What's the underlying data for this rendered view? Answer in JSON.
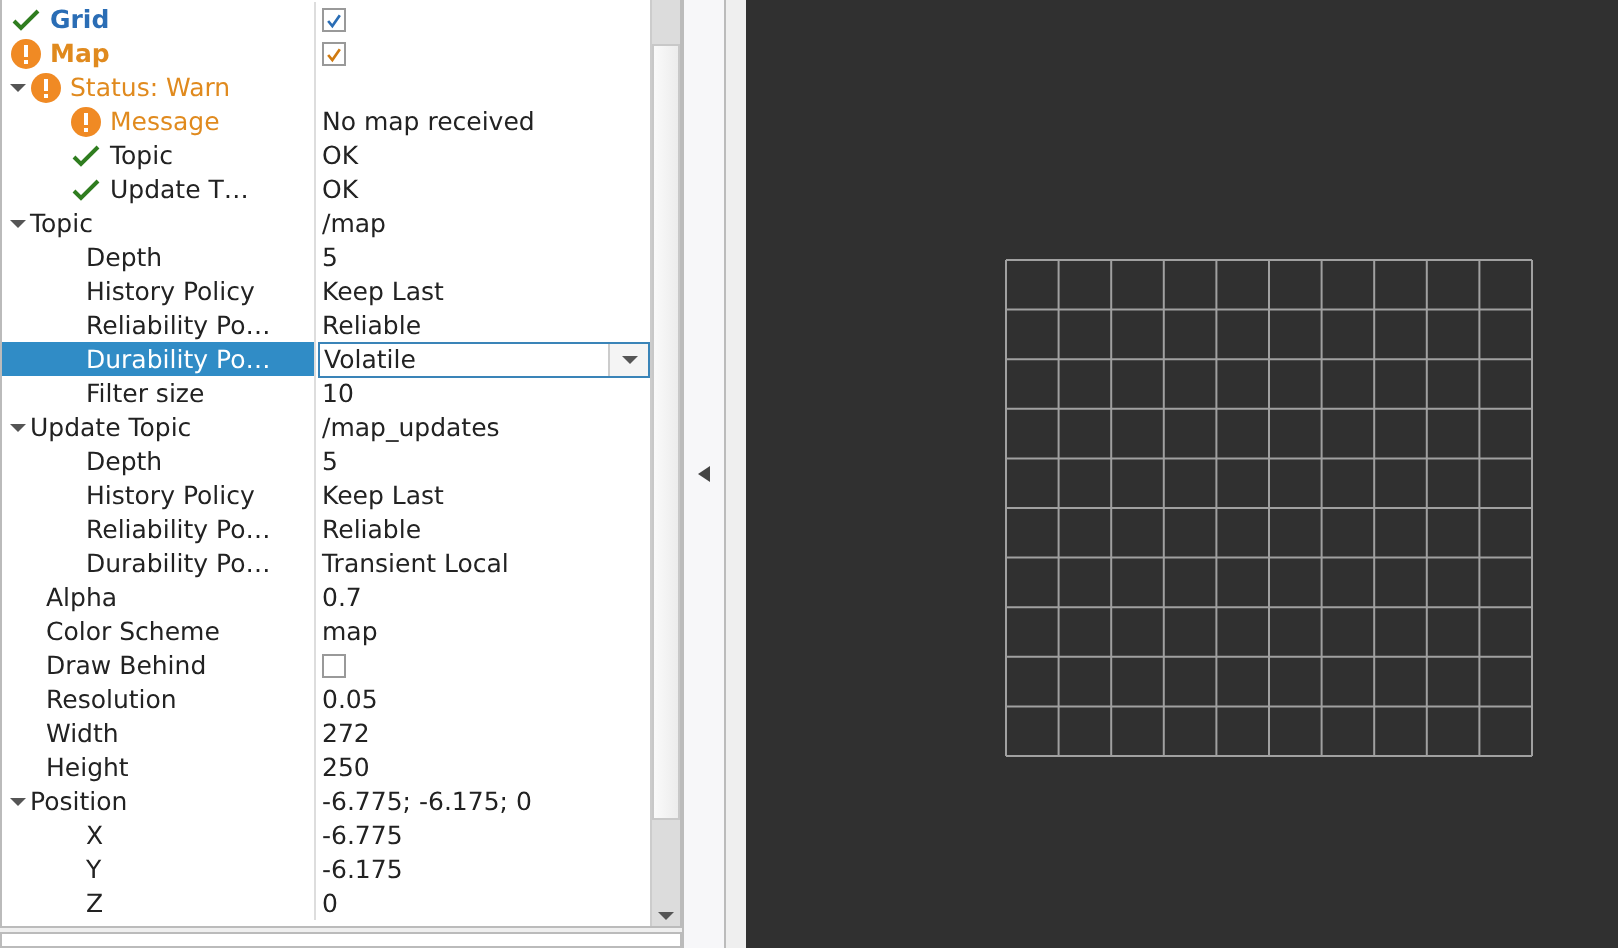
{
  "properties": [
    {
      "label": "Grid",
      "ok": true,
      "kind": "checkbox",
      "checked": true,
      "selected": false
    },
    {
      "label": "Map",
      "warning": true,
      "kind": "checkbox",
      "checked": true,
      "selected": false,
      "children": [
        {
          "label": "Status: Warn",
          "warning": true,
          "expanded": true,
          "selected": false,
          "children": [
            {
              "label": "Message",
              "warning": true,
              "value": "No map received",
              "selected": false
            },
            {
              "label": "Topic",
              "ok": true,
              "value": "OK",
              "selected": false
            },
            {
              "label": "Update T…",
              "ok": true,
              "value": "OK",
              "selected": false
            }
          ]
        },
        {
          "label": "Topic",
          "value": "/map",
          "expanded": true,
          "selected": false,
          "children": [
            {
              "label": "Depth",
              "value": "5",
              "selected": false
            },
            {
              "label": "History Policy",
              "value": "Keep Last",
              "selected": false
            },
            {
              "label": "Reliability Po…",
              "value": "Reliable",
              "selected": false
            },
            {
              "label": "Durability Po…",
              "value": "Volatile",
              "kind": "combo",
              "selected": true
            },
            {
              "label": "Filter size",
              "value": "10",
              "selected": false
            }
          ]
        },
        {
          "label": "Update Topic",
          "value": "/map_updates",
          "expanded": true,
          "selected": false,
          "children": [
            {
              "label": "Depth",
              "value": "5",
              "selected": false
            },
            {
              "label": "History Policy",
              "value": "Keep Last",
              "selected": false
            },
            {
              "label": "Reliability Po…",
              "value": "Reliable",
              "selected": false
            },
            {
              "label": "Durability Po…",
              "value": "Transient Local",
              "selected": false
            }
          ]
        },
        {
          "label": "Alpha",
          "value": "0.7",
          "selected": false
        },
        {
          "label": "Color Scheme",
          "value": "map",
          "selected": false
        },
        {
          "label": "Draw Behind",
          "kind": "checkbox",
          "checked": false,
          "selected": false
        },
        {
          "label": "Resolution",
          "value": "0.05",
          "selected": false
        },
        {
          "label": "Width",
          "value": "272",
          "selected": false
        },
        {
          "label": "Height",
          "value": "250",
          "selected": false
        },
        {
          "label": "Position",
          "value": "-6.775; -6.175; 0",
          "expanded": true,
          "selected": false,
          "children": [
            {
              "label": "X",
              "value": "-6.775",
              "selected": false
            },
            {
              "label": "Y",
              "value": "-6.175",
              "selected": false
            },
            {
              "label": "Z",
              "value": "0",
              "selected": false
            }
          ]
        }
      ]
    }
  ]
}
